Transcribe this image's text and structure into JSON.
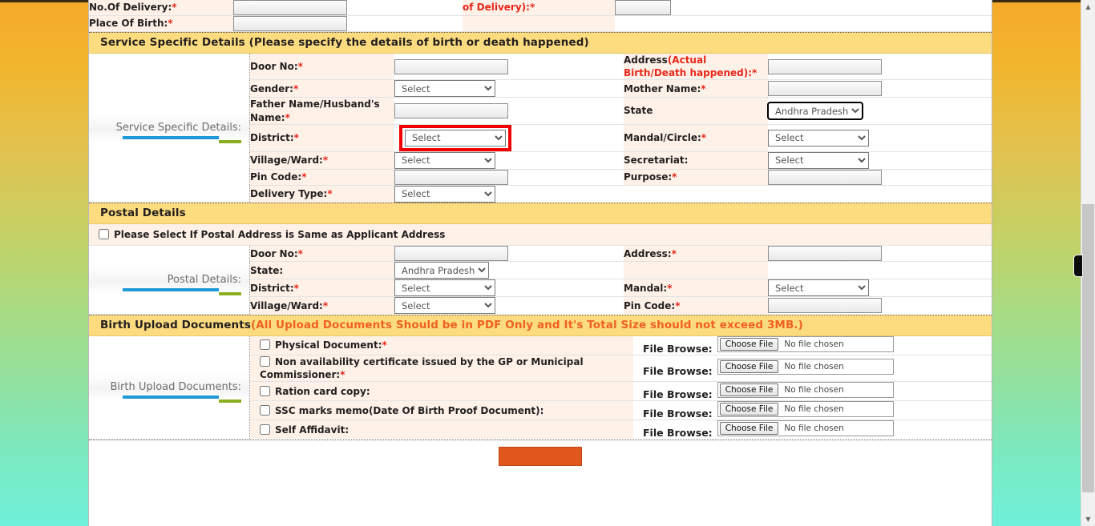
{
  "top_rows": [
    {
      "left_label": "No.Of Delivery:",
      "left_req": "*",
      "right_label": "of Delivery)",
      "right_req": ":*"
    },
    {
      "left_label": "Place Of Birth:",
      "left_req": "*",
      "right_label": "",
      "right_req": ""
    }
  ],
  "service_section": {
    "header": "Service Specific Details (Please specify the details of birth or death happened)",
    "caption": "Service Specific Details:",
    "rows": [
      {
        "l_label": "Door No:",
        "l_req": "*",
        "l_type": "text",
        "l_value": "",
        "r_label": "Address",
        "r_label_red": "(Actual Birth/Death happened)",
        "r_req": ":*",
        "r_type": "text",
        "r_value": ""
      },
      {
        "l_label": "Gender:",
        "l_req": "*",
        "l_type": "select",
        "l_value": "Select",
        "r_label": "Mother Name:",
        "r_label_red": "",
        "r_req": "*",
        "r_type": "text",
        "r_value": ""
      },
      {
        "l_label": "Father Name/Husband's Name:",
        "l_req": "*",
        "l_type": "text",
        "l_value": "",
        "r_label": "State",
        "r_label_red": "",
        "r_req": "",
        "r_type": "select-focus",
        "r_value": "Andhra Pradesh"
      },
      {
        "l_label": "District:",
        "l_req": "*",
        "l_type": "select-highlight",
        "l_value": "Select",
        "r_label": "Mandal/Circle:",
        "r_label_red": "",
        "r_req": "*",
        "r_type": "select",
        "r_value": "Select"
      },
      {
        "l_label": "Village/Ward:",
        "l_req": "*",
        "l_type": "select",
        "l_value": "Select",
        "r_label": "Secretariat:",
        "r_label_red": "",
        "r_req": "",
        "r_type": "select",
        "r_value": "Select"
      },
      {
        "l_label": "Pin Code:",
        "l_req": "*",
        "l_type": "text",
        "l_value": "",
        "r_label": "Purpose:",
        "r_label_red": "",
        "r_req": "*",
        "r_type": "text",
        "r_value": ""
      },
      {
        "l_label": "Delivery Type:",
        "l_req": "*",
        "l_type": "select",
        "l_value": "Select",
        "r_label": "",
        "r_label_red": "",
        "r_req": "",
        "r_type": "none",
        "r_value": ""
      }
    ]
  },
  "postal_section": {
    "header": "Postal Details",
    "same_address_label": "Please Select If Postal Address is Same as Applicant Address",
    "same_address_checked": false,
    "caption": "Postal Details:",
    "rows": [
      {
        "l_label": "Door No:",
        "l_req": "*",
        "l_type": "text",
        "l_value": "",
        "r_label": "Address:",
        "r_req": "*",
        "r_type": "text",
        "r_value": ""
      },
      {
        "l_label": "State:",
        "l_req": "",
        "l_type": "select-narrow",
        "l_value": "Andhra Pradesh",
        "r_label": "",
        "r_req": "",
        "r_type": "none",
        "r_value": ""
      },
      {
        "l_label": "District:",
        "l_req": "*",
        "l_type": "select",
        "l_value": "Select",
        "r_label": "Mandal:",
        "r_req": "*",
        "r_type": "select",
        "r_value": "Select"
      },
      {
        "l_label": "Village/Ward:",
        "l_req": "*",
        "l_type": "select",
        "l_value": "Select",
        "r_label": "Pin Code:",
        "r_req": "*",
        "r_type": "text",
        "r_value": ""
      }
    ]
  },
  "upload_section": {
    "header_main": "Birth Upload Documents",
    "header_note": "(All Upload Documents Should be in PDF Only and It's Total Size should not exceed 3MB.)",
    "caption": "Birth Upload Documents:",
    "file_browse_label": "File Browse:",
    "choose_file_label": "Choose File",
    "no_file_label": "No file chosen",
    "documents": [
      {
        "label": "Physical Document:",
        "req": "*",
        "checked": false
      },
      {
        "label": "Non availability certificate issued by the GP or Municipal Commissioner:",
        "req": "*",
        "checked": false
      },
      {
        "label": "Ration card copy:",
        "req": "",
        "checked": false
      },
      {
        "label": "SSC marks memo(Date Of Birth Proof Document):",
        "req": "",
        "checked": false
      },
      {
        "label": "Self Affidavit:",
        "req": "",
        "checked": false
      }
    ]
  },
  "submit": {
    "label": ""
  },
  "colors": {
    "section_header_bg": "#fcdc7e",
    "label_cell_bg": "#fdf1e8",
    "required_red": "#e8281a",
    "note_orange": "#ef6022",
    "highlight_red": "#f40000",
    "accent_blue": "#1b9ad6",
    "accent_green": "#8aae1e",
    "submit_orange": "#e0561d"
  }
}
